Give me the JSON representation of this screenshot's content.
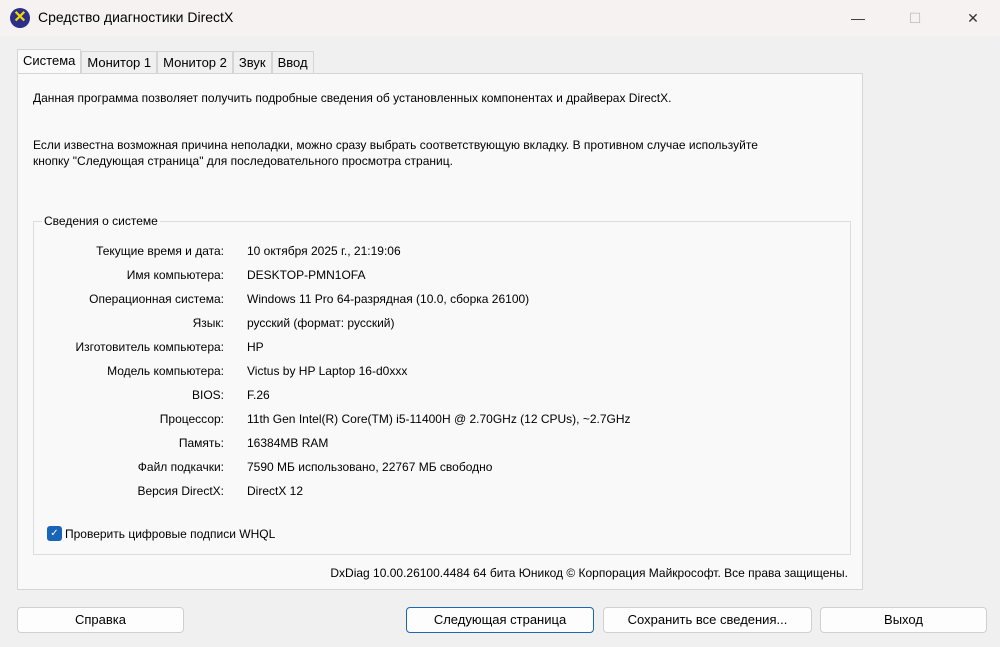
{
  "window": {
    "title": "Средство диагностики DirectX",
    "minimize": "—",
    "maximize": "☐",
    "close": "✕"
  },
  "tabs": [
    "Система",
    "Монитор 1",
    "Монитор 2",
    "Звук",
    "Ввод"
  ],
  "intro": "Данная программа позволяет получить подробные сведения об установленных компонентах и драйверах DirectX.",
  "hint_line1": "Если известна возможная причина неполадки, можно сразу выбрать соответствующую вкладку. В противном случае используйте",
  "hint_line2": "кнопку \"Следующая страница\" для последовательного просмотра страниц.",
  "group": {
    "title": "Сведения о системе",
    "rows": [
      {
        "label": "Текущие время и дата:",
        "value": "10 октября 2025 г., 21:19:06"
      },
      {
        "label": "Имя компьютера:",
        "value": "DESKTOP-PMN1OFA"
      },
      {
        "label": "Операционная система:",
        "value": "Windows 11 Pro 64-разрядная (10.0, сборка 26100)"
      },
      {
        "label": "Язык:",
        "value": "русский (формат: русский)"
      },
      {
        "label": "Изготовитель компьютера:",
        "value": "HP"
      },
      {
        "label": "Модель компьютера:",
        "value": "Victus by HP Laptop 16-d0xxx"
      },
      {
        "label": "BIOS:",
        "value": "F.26"
      },
      {
        "label": "Процессор:",
        "value": "11th Gen Intel(R) Core(TM) i5-11400H @ 2.70GHz (12 CPUs), ~2.7GHz"
      },
      {
        "label": "Память:",
        "value": "16384MB RAM"
      },
      {
        "label": "Файл подкачки:",
        "value": "7590 МБ использовано, 22767 МБ свободно"
      },
      {
        "label": "Версия DirectX:",
        "value": "DirectX 12"
      }
    ],
    "checkbox": {
      "label": "Проверить цифровые подписи WHQL",
      "checked": true
    }
  },
  "footer": "DxDiag 10.00.26100.4484 64 бита Юникод © Корпорация Майкрософт. Все права защищены.",
  "buttons": {
    "help": "Справка",
    "next": "Следующая страница",
    "save": "Сохранить все сведения...",
    "exit": "Выход"
  }
}
